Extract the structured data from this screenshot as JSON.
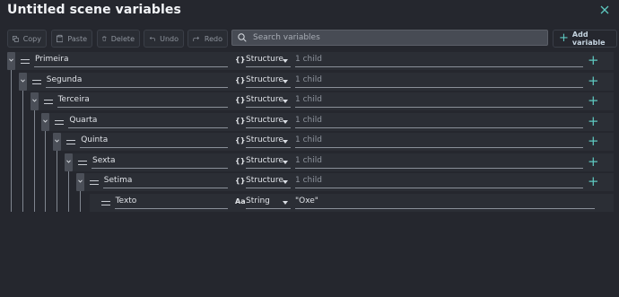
{
  "window": {
    "title": "Untitled scene variables"
  },
  "toolbar": {
    "copy": "Copy",
    "paste": "Paste",
    "delete": "Delete",
    "undo": "Undo",
    "redo": "Redo",
    "add_variable": "Add variable"
  },
  "search": {
    "placeholder": "Search variables",
    "value": ""
  },
  "colors": {
    "accent": "#5ec8c0",
    "background": "#25272e",
    "row": "#2b2e35"
  },
  "icons": {
    "type_structure": "{}",
    "type_string": "Aa"
  },
  "variables": [
    {
      "name": "Primeira",
      "depth": 0,
      "type": "Structure",
      "value": "1 child"
    },
    {
      "name": "Segunda",
      "depth": 1,
      "type": "Structure",
      "value": "1 child"
    },
    {
      "name": "Terceira",
      "depth": 2,
      "type": "Structure",
      "value": "1 child"
    },
    {
      "name": "Quarta",
      "depth": 3,
      "type": "Structure",
      "value": "1 child"
    },
    {
      "name": "Quinta",
      "depth": 4,
      "type": "Structure",
      "value": "1 child"
    },
    {
      "name": "Sexta",
      "depth": 5,
      "type": "Structure",
      "value": "1 child"
    },
    {
      "name": "Setima",
      "depth": 6,
      "type": "Structure",
      "value": "1 child"
    },
    {
      "name": "Texto",
      "depth": 7,
      "type": "String",
      "value": "\"Oxe\""
    }
  ]
}
